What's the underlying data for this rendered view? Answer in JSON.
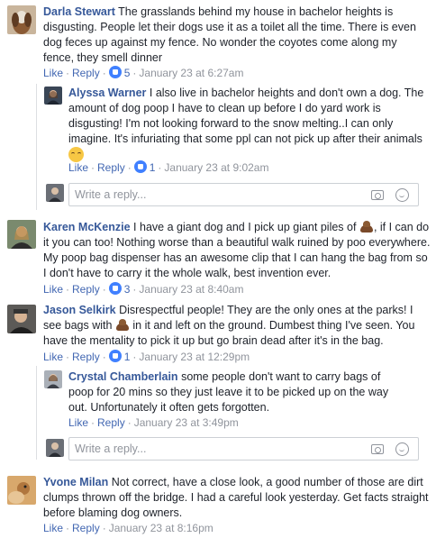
{
  "comments": [
    {
      "name": "Darla Stewart",
      "text": "The grasslands behind my house in bachelor heights is disgusting. People let their dogs use it as a toilet all the time. There is even dog feces up against my fence. No wonder the coyotes come along my fence, they smell dinner",
      "like_label": "Like",
      "reply_label": "Reply",
      "likes": "5",
      "time": "January 23 at 6:27am",
      "replies": [
        {
          "name": "Alyssa Warner",
          "text": "I also live in bachelor heights and don't own a dog. The amount of dog poop I have to clean up before I do yard work is disgusting! I'm not looking forward to the snow melting..I can only imagine. It's infuriating that some ppl can not pick up after their animals",
          "like_label": "Like",
          "reply_label": "Reply",
          "likes": "1",
          "time": "January 23 at 9:02am"
        }
      ],
      "reply_placeholder": "Write a reply..."
    },
    {
      "name": "Karen McKenzie",
      "text_a": "I have a giant dog and I pick up giant piles of",
      "text_b": ", if I can do it you can too! Nothing worse than a beautiful walk ruined by poo everywhere. My poop bag dispenser has an awesome clip that I can hang the bag from so I don't have to carry it the whole walk, best invention ever.",
      "like_label": "Like",
      "reply_label": "Reply",
      "likes": "3",
      "time": "January 23 at 8:40am"
    },
    {
      "name": "Jason Selkirk",
      "text_a": "Disrespectful people! They are the only ones at the parks! I see bags with",
      "text_b": "in it and left on the ground. Dumbest thing I've seen. You have the mentality to pick it up but go brain dead after it's in the bag.",
      "like_label": "Like",
      "reply_label": "Reply",
      "likes": "1",
      "time": "January 23 at 12:29pm",
      "replies": [
        {
          "name": "Crystal Chamberlain",
          "text": "some people don't want to carry bags of poop for 20 mins so they just leave it to be picked up on the way out. Unfortunately it often gets forgotten.",
          "like_label": "Like",
          "reply_label": "Reply",
          "time": "January 23 at 3:49pm"
        }
      ],
      "reply_placeholder": "Write a reply..."
    },
    {
      "name": "Yvone Milan",
      "text": "Not correct, have a close look, a good number of those are dirt clumps thrown off the bridge. I had a careful look yesterday. Get facts straight before blaming dog owners.",
      "like_label": "Like",
      "reply_label": "Reply",
      "time": "January 23 at 8:16pm"
    }
  ],
  "colors": {
    "name": "#365899",
    "link": "#4267b2",
    "meta": "#90949c",
    "like_badge": "#4080ff"
  }
}
